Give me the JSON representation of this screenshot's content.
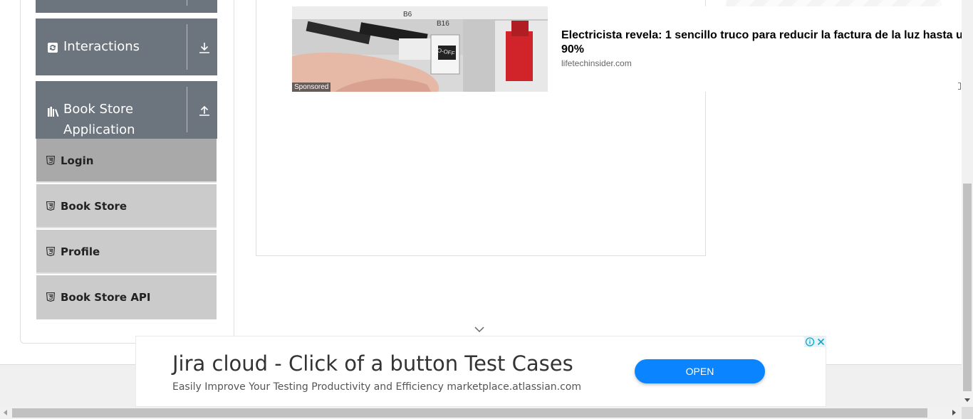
{
  "sidebar": {
    "groups": [
      {
        "label": "Interactions",
        "icon": "interactions-icon",
        "toggle": "expand-arrow-down-icon"
      },
      {
        "label": "Book Store Application",
        "icon": "bookshelf-icon",
        "toggle": "collapse-arrow-up-icon"
      }
    ],
    "items": [
      {
        "label": "Login",
        "icon": "html5-icon",
        "active": true
      },
      {
        "label": "Book Store",
        "icon": "html5-icon",
        "active": false
      },
      {
        "label": "Profile",
        "icon": "html5-icon",
        "active": false
      },
      {
        "label": "Book Store API",
        "icon": "html5-icon",
        "active": false
      }
    ]
  },
  "top_ad": {
    "sponsored_label": "Sponsored",
    "headline_line1": "Electricista revela: 1 sencillo truco para reducir la factura de la luz hasta u",
    "headline_line2": "90%",
    "domain": "lifetechinsider.com",
    "photo_breaker_labels": [
      "B6",
      "B16",
      "O-OFF"
    ]
  },
  "bottom_ad": {
    "title": "Jira cloud - Click of a button Test Cases",
    "subtitle": "Easily Improve Your Testing Productivity and Efficiency marketplace.atlassian.com",
    "button_label": "OPEN"
  },
  "colors": {
    "sidebar_header": "#6c757d",
    "menu_item": "#cbcbcb",
    "menu_item_active": "#a9a9a9",
    "open_button": "#0a84ff"
  }
}
